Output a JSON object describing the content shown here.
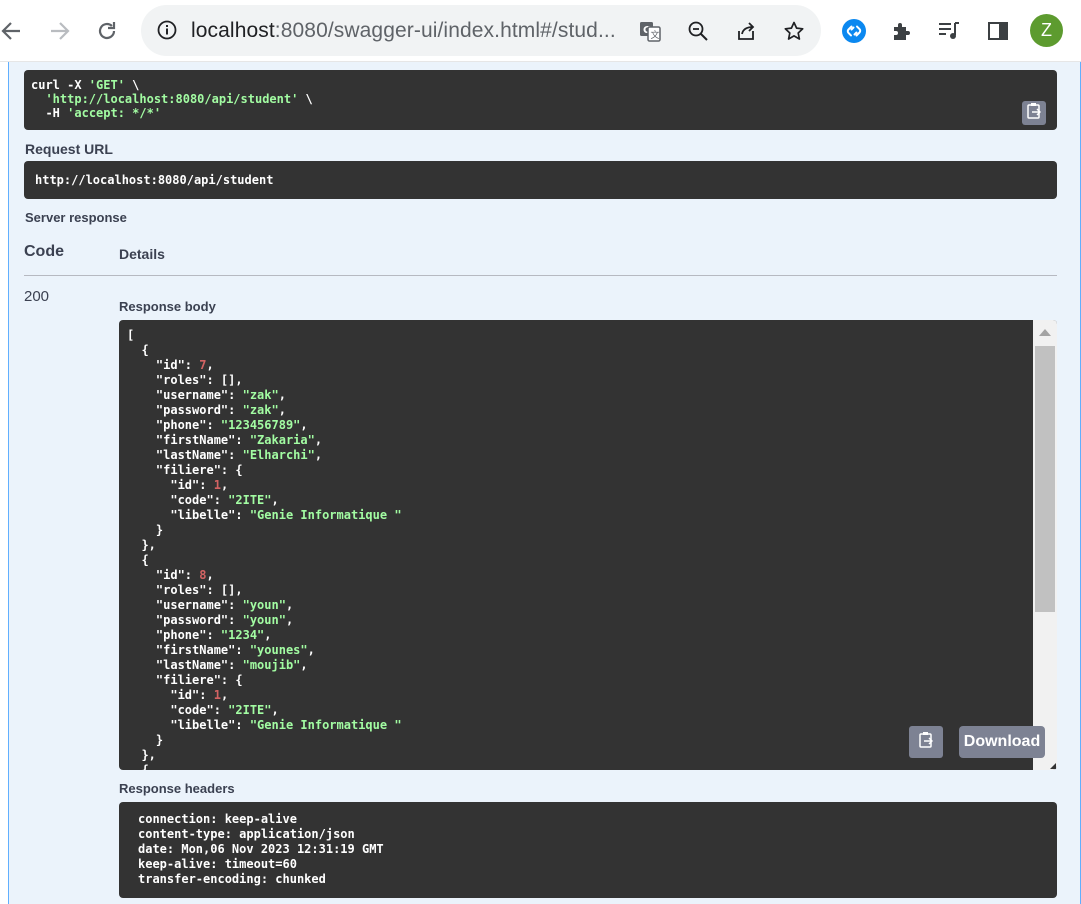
{
  "browser": {
    "url_host": "localhost",
    "url_rest": ":8080/swagger-ui/index.html#/stud...",
    "profile_initial": "Z",
    "icons": [
      "back-arrow-icon",
      "forward-arrow-icon",
      "reload-icon",
      "info-icon",
      "translate-icon",
      "zoom-out-icon",
      "share-icon",
      "star-icon",
      "shazam-icon",
      "extensions-icon",
      "media-icon",
      "side-panel-icon"
    ]
  },
  "curl": {
    "line1_cmd": "curl -X ",
    "line1_method": "'GET'",
    "line1_end": " \\",
    "line2_url": "'http://localhost:8080/api/student'",
    "line2_end": " \\",
    "line3_flag": "-H ",
    "line3_header": "'accept: */*'"
  },
  "request_url": {
    "label": "Request URL",
    "value": "http://localhost:8080/api/student"
  },
  "server_response": {
    "label": "Server response",
    "col_code": "Code",
    "col_details": "Details",
    "code": "200",
    "body_label": "Response body",
    "download_label": "Download",
    "students": [
      {
        "id": 7,
        "username": "zak",
        "password": "zak",
        "phone": "123456789",
        "firstName": "Zakaria",
        "lastName": "Elharchi",
        "filiere": {
          "id": 1,
          "code": "2ITE",
          "libelle": "Genie Informatique "
        }
      },
      {
        "id": 8,
        "username": "youn",
        "password": "youn",
        "phone": "1234",
        "firstName": "younes",
        "lastName": "moujib",
        "filiere": {
          "id": 1,
          "code": "2ITE",
          "libelle": "Genie Informatique "
        }
      }
    ],
    "headers_label": "Response headers",
    "headers": [
      "connection: keep-alive",
      "content-type: application/json",
      "date: Mon,06 Nov 2023 12:31:19 GMT",
      "keep-alive: timeout=60",
      "transfer-encoding: chunked"
    ]
  },
  "colors": {
    "code_bg": "#333333",
    "json_string": "#a2fca2",
    "json_number": "#d36363",
    "page_bg": "#ebf3fb",
    "button_gray": "#7d8293"
  }
}
